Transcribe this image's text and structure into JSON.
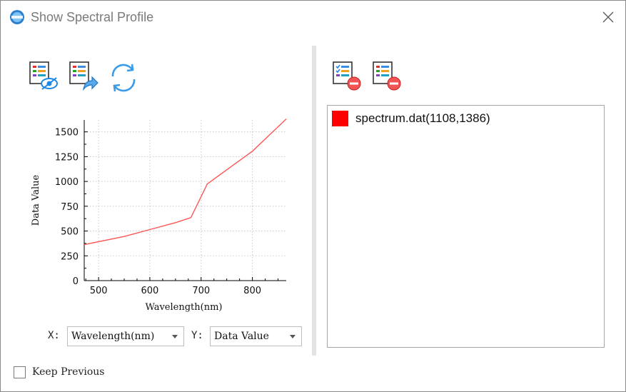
{
  "window": {
    "title": "Show Spectral Profile"
  },
  "icons": {
    "app": "app-logo-icon",
    "close": "close-icon",
    "left_toolbar": [
      "show-spectrum-list-icon",
      "export-spectrum-icon",
      "refresh-icon"
    ],
    "right_toolbar": [
      "remove-selected-icon",
      "remove-all-icon"
    ]
  },
  "axes": {
    "x_label": "X:",
    "x_value": "Wavelength(nm)",
    "y_label": "Y:",
    "y_value": "Data Value"
  },
  "spectra": [
    {
      "label": "spectrum.dat(1108,1386)",
      "color": "#ff0000"
    }
  ],
  "keep_previous": {
    "label": "Keep Previous",
    "checked": false
  },
  "chart_data": {
    "type": "line",
    "xlabel": "Wavelength(nm)",
    "ylabel": "Data Value",
    "xlim": [
      472,
      866
    ],
    "ylim": [
      0,
      1620
    ],
    "xticks": [
      500,
      600,
      700,
      800
    ],
    "yticks": [
      0,
      250,
      500,
      750,
      1000,
      1250,
      1500
    ],
    "grid": true,
    "series": [
      {
        "color": "#ff5555",
        "x": [
          472,
          550,
          600,
          650,
          680,
          712,
          760,
          800,
          866
        ],
        "y": [
          363,
          445,
          515,
          585,
          635,
          975,
          1155,
          1305,
          1630
        ]
      }
    ]
  }
}
